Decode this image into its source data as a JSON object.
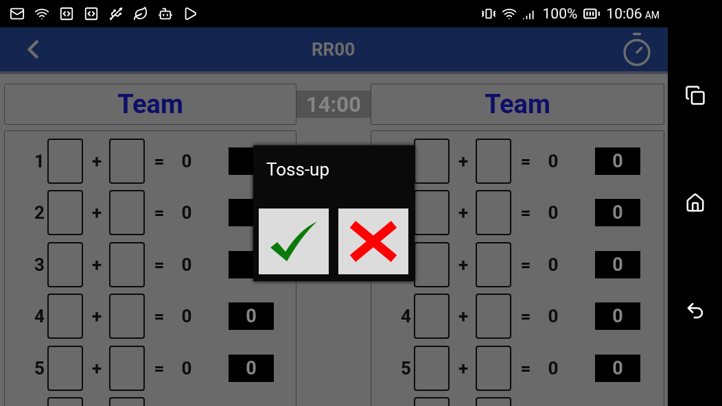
{
  "status_bar": {
    "battery": "100%",
    "time": "10:06",
    "time_suffix": "AM"
  },
  "app_bar": {
    "title": "RR00"
  },
  "timer": "14:00",
  "teams": [
    {
      "name": "Team",
      "rows": [
        {
          "kind": "full",
          "number": "1",
          "plus": "+",
          "equals": "=",
          "sum": "0"
        },
        {
          "kind": "full",
          "number": "2",
          "plus": "+",
          "equals": "=",
          "sum": "0"
        },
        {
          "kind": "full",
          "number": "3",
          "plus": "+",
          "equals": "=",
          "sum": "0"
        },
        {
          "kind": "full",
          "number": "4",
          "plus": "+",
          "equals": "=",
          "sum": "0",
          "score": "0"
        },
        {
          "kind": "full",
          "number": "5",
          "plus": "+",
          "equals": "=",
          "sum": "0",
          "score": "0"
        },
        {
          "kind": "partial"
        }
      ]
    },
    {
      "name": "Team",
      "rows": [
        {
          "kind": "full",
          "plus": "+",
          "equals": "=",
          "sum": "0",
          "score": "0"
        },
        {
          "kind": "full",
          "plus": "+",
          "equals": "=",
          "sum": "0",
          "score": "0"
        },
        {
          "kind": "full",
          "plus": "+",
          "equals": "=",
          "sum": "0",
          "score": "0"
        },
        {
          "kind": "full",
          "number": "4",
          "plus": "+",
          "equals": "=",
          "sum": "0",
          "score": "0"
        },
        {
          "kind": "full",
          "number": "5",
          "plus": "+",
          "equals": "=",
          "sum": "0",
          "score": "0"
        },
        {
          "kind": "partial"
        }
      ]
    }
  ],
  "dialog": {
    "title": "Toss-up"
  }
}
